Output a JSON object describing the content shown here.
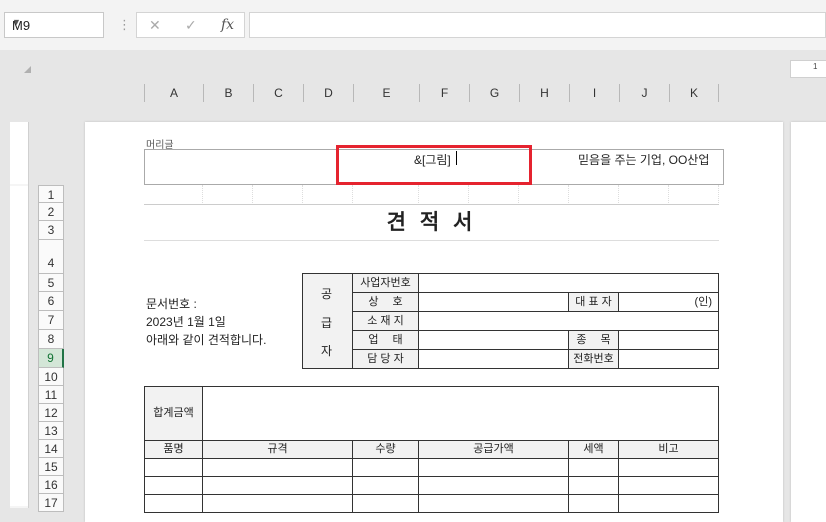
{
  "namebox": {
    "value": "M9"
  },
  "formula_bar": {
    "cancel": "✕",
    "confirm": "✓",
    "fx": "fx",
    "value": ""
  },
  "ruler_top_label": "1",
  "columns": [
    "A",
    "B",
    "C",
    "D",
    "E",
    "F",
    "G",
    "H",
    "I",
    "J",
    "K"
  ],
  "rows": [
    "1",
    "2",
    "3",
    "4",
    "5",
    "6",
    "7",
    "8",
    "9",
    "10",
    "11",
    "12",
    "13",
    "14",
    "15",
    "16",
    "17"
  ],
  "selected_row": "9",
  "header": {
    "label": "머리글",
    "center": "&[그림]",
    "right": "믿음을 주는 기업, OO산업"
  },
  "sheet": {
    "title": "견 적 서",
    "doc_number": "문서번호 :",
    "date": "2023년 1월 1일",
    "intro": "아래와 같이 견적합니다.",
    "supplier_chars": [
      "공",
      "급",
      "자"
    ],
    "supplier_fields": [
      "사업자번호",
      "상　 호",
      "소 재 지",
      "업 　태",
      "담 당 자"
    ],
    "representative_label": "대 표 자",
    "seal": "(인)",
    "item_label": "종 　목",
    "phone_label": "전화번호",
    "total_label": "합계금액",
    "item_headers": [
      "품명",
      "규격",
      "수량",
      "공급가액",
      "세액",
      "비고"
    ]
  }
}
